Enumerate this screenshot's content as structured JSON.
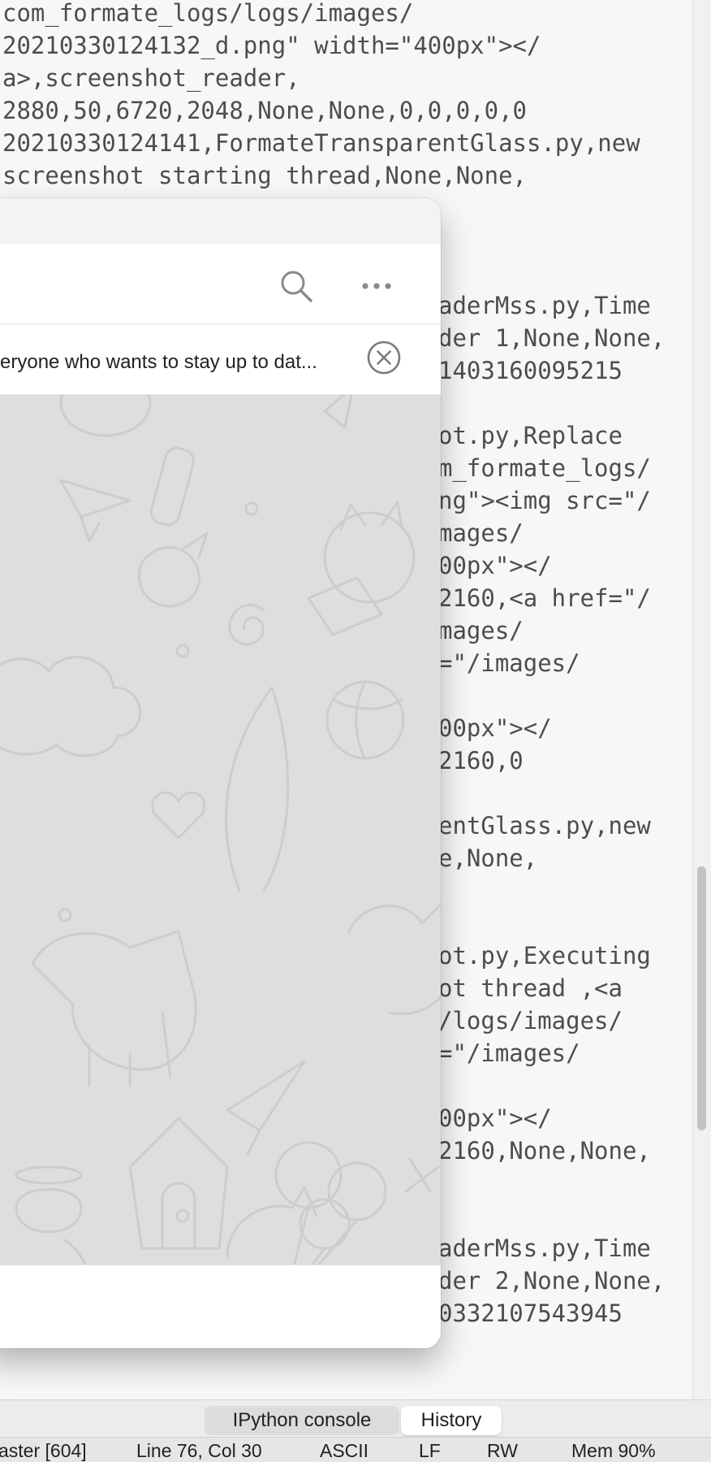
{
  "history": {
    "lines_top": [
      "com_formate_logs/logs/images/",
      "20210330124132_d.png\" width=\"400px\"></",
      "a>,screenshot_reader,",
      "2880,50,6720,2048,None,None,0,0,0,0,0",
      "20210330124141,FormateTransparentGlass.py,new",
      "screenshot starting thread,None,None,"
    ],
    "lines_right": [
      "aderMss.py,Time",
      "der 1,None,None,",
      "1403160095215",
      "",
      "ot.py,Replace",
      "m_formate_logs/",
      "ng\"><img src=\"/",
      "mages/",
      "00px\"></",
      "2160,<a href=\"/",
      "mages/",
      "=\"/images/",
      "",
      "00px\"></",
      "2160,0",
      "",
      "entGlass.py,new",
      "e,None,",
      "",
      "",
      "ot.py,Executing",
      "ot thread ,<a",
      "/logs/images/",
      "=\"/images/",
      "",
      "00px\"></",
      "2160,None,None,",
      "",
      "",
      "aderMss.py,Time",
      "der 2,None,None,",
      "0332107543945"
    ]
  },
  "chat": {
    "pinned_message": "eryone who wants to stay up to dat...",
    "icons": {
      "search": "search-icon",
      "more": "more-icon",
      "close": "close-circle-icon"
    }
  },
  "tabs": [
    {
      "label": "IPython console",
      "active": false
    },
    {
      "label": "History",
      "active": true
    }
  ],
  "statusbar": {
    "branch": "aster [604]",
    "position": "Line 76, Col 30",
    "encoding": "ASCII",
    "eol": "LF",
    "permissions": "RW",
    "memory": "Mem 90%"
  }
}
